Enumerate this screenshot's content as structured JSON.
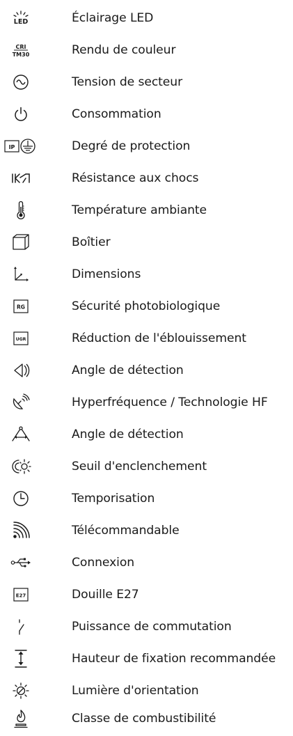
{
  "items": [
    {
      "label": "Éclairage LED",
      "icon": "led-lighting-icon",
      "icon_text": "LED"
    },
    {
      "label": "Rendu de couleur",
      "icon": "color-rendering-icon",
      "icon_text_top": "CRI",
      "icon_text_bottom": "TM30"
    },
    {
      "label": "Tension de secteur",
      "icon": "mains-voltage-icon"
    },
    {
      "label": "Consommation",
      "icon": "power-icon"
    },
    {
      "label": "Degré de protection",
      "icon": "ip-protection-icon",
      "icon_text": "IP"
    },
    {
      "label": "Résistance aux chocs",
      "icon": "impact-resistance-icon",
      "icon_text": "IK"
    },
    {
      "label": "Température ambiante",
      "icon": "thermometer-icon"
    },
    {
      "label": "Boîtier",
      "icon": "housing-icon"
    },
    {
      "label": "Dimensions",
      "icon": "dimensions-icon"
    },
    {
      "label": "Sécurité photobiologique",
      "icon": "photobiological-safety-icon",
      "icon_text": "RG"
    },
    {
      "label": "Réduction de l'éblouissement",
      "icon": "glare-reduction-icon",
      "icon_text": "UGR"
    },
    {
      "label": "Angle de détection",
      "icon": "detection-angle-icon"
    },
    {
      "label": "Hyperfréquence / Technologie HF",
      "icon": "hf-technology-icon"
    },
    {
      "label": "Angle de détection",
      "icon": "detection-angle-top-icon"
    },
    {
      "label": "Seuil d'enclenchement",
      "icon": "switching-threshold-icon"
    },
    {
      "label": "Temporisation",
      "icon": "clock-icon"
    },
    {
      "label": "Télécommandable",
      "icon": "remote-control-icon"
    },
    {
      "label": "Connexion",
      "icon": "usb-icon"
    },
    {
      "label": "Douille E27",
      "icon": "e27-socket-icon",
      "icon_text": "E27"
    },
    {
      "label": "Puissance de commutation",
      "icon": "switching-power-icon"
    },
    {
      "label": "Hauteur de fixation recommandée",
      "icon": "mounting-height-icon"
    },
    {
      "label": "Lumière d'orientation",
      "icon": "orientation-light-icon"
    },
    {
      "label": "Classe de combustibilité",
      "icon": "flammability-class-icon"
    }
  ]
}
